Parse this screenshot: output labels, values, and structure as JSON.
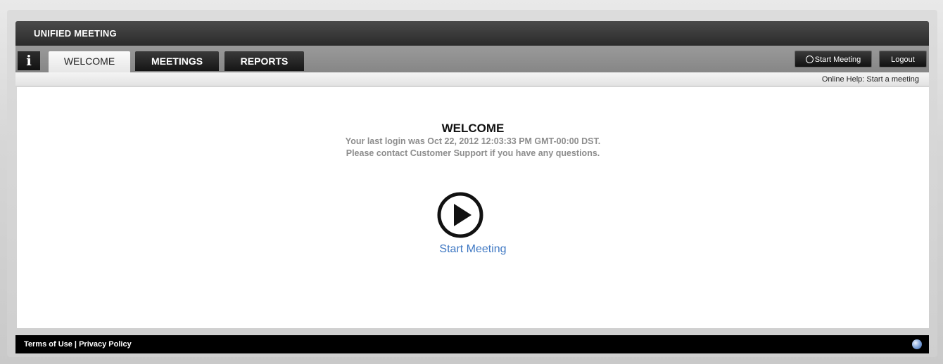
{
  "app": {
    "title": "UNIFIED MEETING"
  },
  "tabs": [
    {
      "label": "WELCOME",
      "active": true
    },
    {
      "label": "MEETINGS",
      "active": false
    },
    {
      "label": "REPORTS",
      "active": false
    }
  ],
  "info_button": {
    "label": "i"
  },
  "toolbar": {
    "start_meeting_label": "Start Meeting",
    "logout_label": "Logout"
  },
  "help": {
    "text": "Online Help: Start a meeting"
  },
  "welcome": {
    "title": "WELCOME",
    "last_login": "Your last login was Oct 22, 2012 12:03:33 PM GMT-00:00 DST.",
    "support": "Please contact Customer Support if you have any questions.",
    "start_link": "Start Meeting"
  },
  "footer": {
    "terms": "Terms of Use",
    "separator": " | ",
    "privacy": "Privacy Policy"
  },
  "colors": {
    "link": "#3f78c3",
    "titlebar": "#2b2b2b"
  },
  "icons": {
    "play": "play-circle-icon",
    "globe": "globe-icon",
    "info": "info-icon"
  }
}
